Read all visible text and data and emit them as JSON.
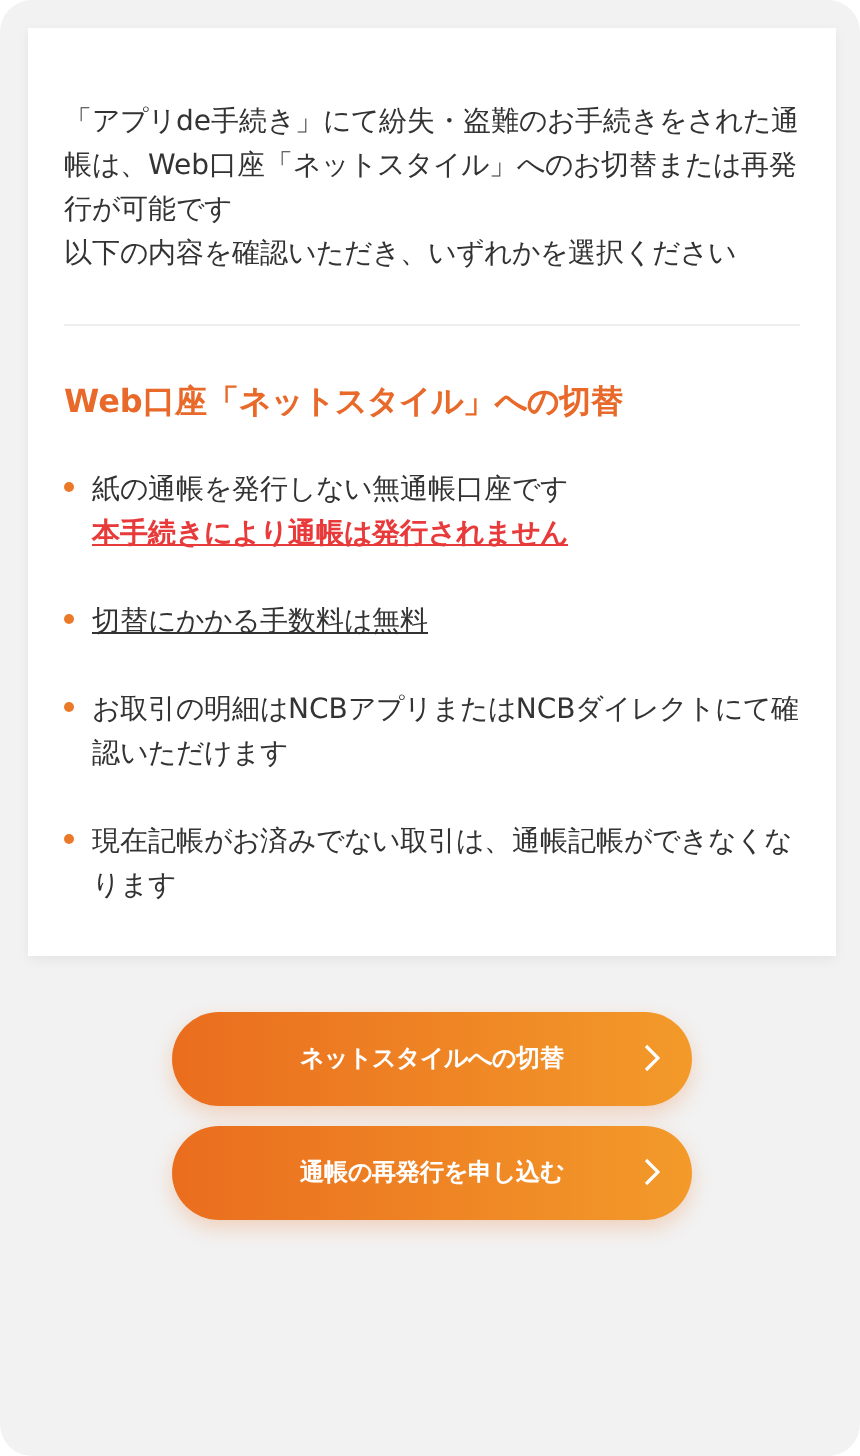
{
  "intro": [
    "「アプリde手続き」にて紛失・盗難のお手続きをされた通帳は、Web口座「ネットスタイル」へのお切替または再発行が可能です",
    "以下の内容を確認いただき、いずれかを選択ください"
  ],
  "section": {
    "title": "Web口座「ネットスタイル」への切替",
    "items": [
      {
        "text": "紙の通帳を発行しない無通帳口座です",
        "underlined": false,
        "warning": "本手続きにより通帳は発行されません"
      },
      {
        "text": "切替にかかる手数料は無料",
        "underlined": true
      },
      {
        "text": "お取引の明細はNCBアプリまたはNCBダイレクトにて確認いただけます",
        "underlined": false
      },
      {
        "text": "現在記帳がお済みでない取引は、通帳記帳ができなくなります",
        "underlined": false
      }
    ]
  },
  "buttons": [
    {
      "label": "ネットスタイルへの切替"
    },
    {
      "label": "通帳の再発行を申し込む"
    }
  ]
}
